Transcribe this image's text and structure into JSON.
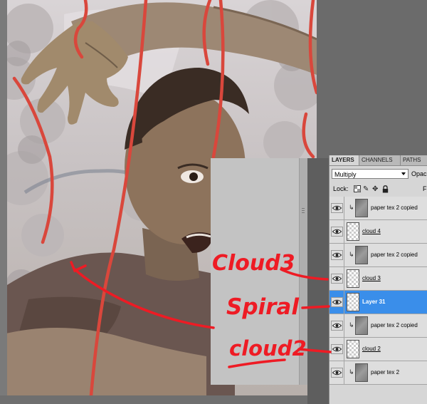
{
  "panel": {
    "tabs": [
      "LAYERS",
      "CHANNELS",
      "PATHS"
    ],
    "blend_mode": "Multiply",
    "opacity_label": "Opac",
    "lock_label": "Lock:",
    "fill_label": "F"
  },
  "layers": [
    {
      "name": "paper tex 2 copied",
      "clipped": true,
      "thumb": "gray",
      "selected": false,
      "underlined": false
    },
    {
      "name": "cloud 4",
      "clipped": false,
      "thumb": "check",
      "selected": false,
      "underlined": true
    },
    {
      "name": "paper tex 2 copied",
      "clipped": true,
      "thumb": "gray",
      "selected": false,
      "underlined": false
    },
    {
      "name": "cloud 3",
      "clipped": false,
      "thumb": "check",
      "selected": false,
      "underlined": true
    },
    {
      "name": "Layer 31",
      "clipped": false,
      "thumb": "check",
      "selected": true,
      "underlined": false
    },
    {
      "name": "paper tex 2 copied",
      "clipped": true,
      "thumb": "gray",
      "selected": false,
      "underlined": false
    },
    {
      "name": "cloud 2",
      "clipped": false,
      "thumb": "check",
      "selected": false,
      "underlined": true
    },
    {
      "name": "paper tex 2",
      "clipped": true,
      "thumb": "gray",
      "selected": false,
      "underlined": false
    }
  ],
  "annotations": {
    "cloud3": "Cloud3",
    "spiral": "Spiral",
    "cloud2": "cloud2"
  },
  "colors": {
    "annotation": "#ee1b24",
    "selection": "#3a8eea",
    "string": "#d9473c"
  }
}
